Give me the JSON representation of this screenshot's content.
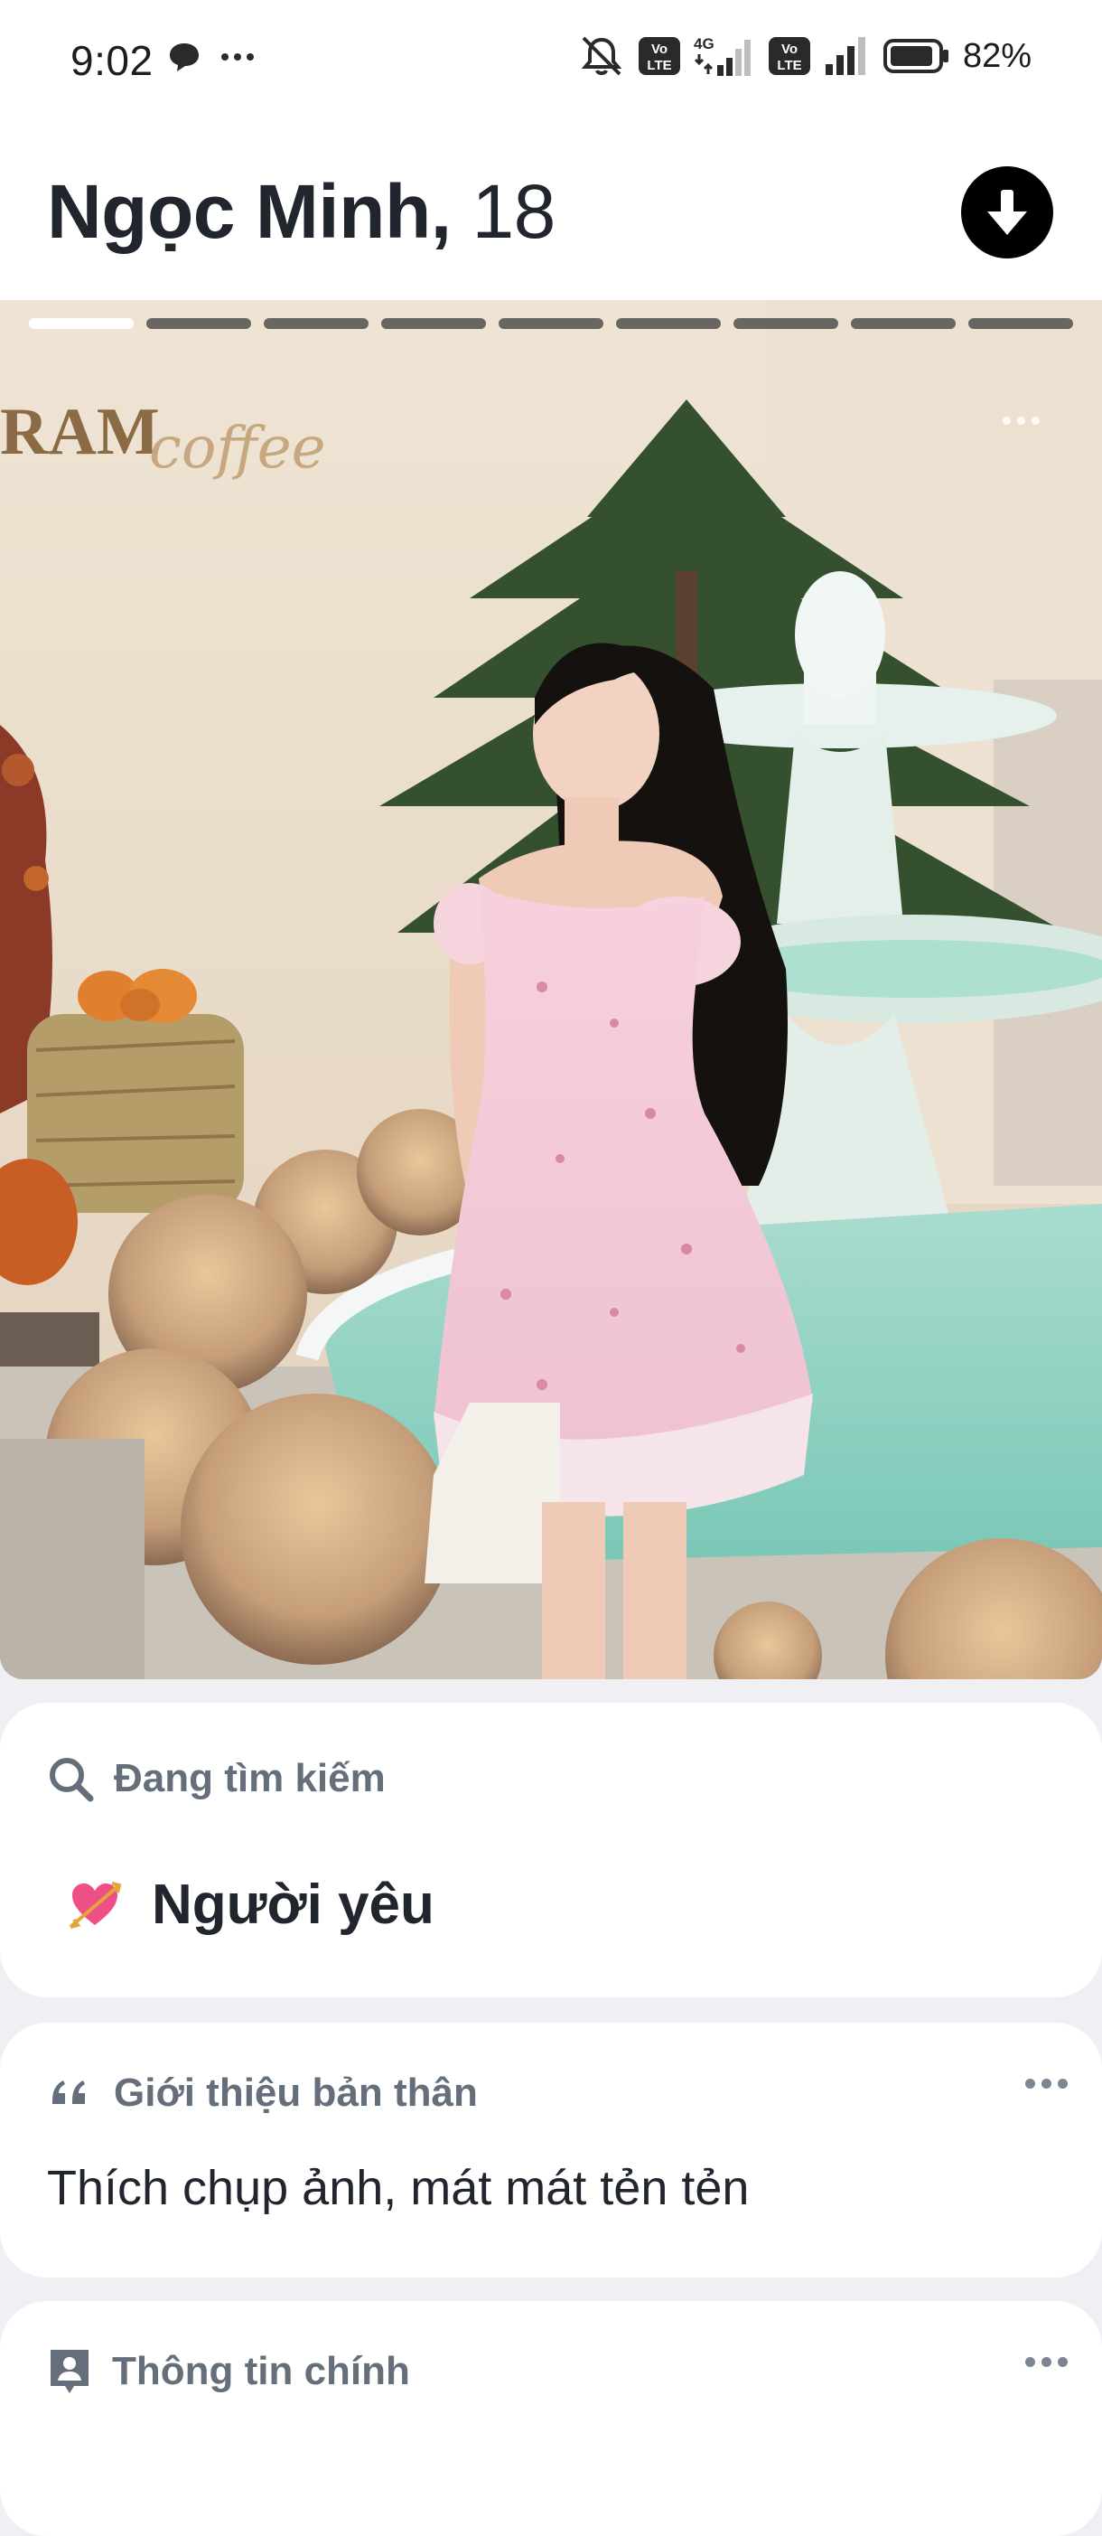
{
  "status_bar": {
    "time": "9:02",
    "battery": "82%",
    "icons": [
      "chat-bubble-icon",
      "more-dots-icon",
      "bell-off-icon",
      "volte-icon",
      "4g-signal-icon",
      "volte-icon",
      "signal-icon",
      "battery-icon"
    ]
  },
  "profile": {
    "name": "Ngọc Minh,",
    "age": "18",
    "photo_count": 9,
    "active_photo_index": 0
  },
  "photo": {
    "sign_text": "RAM",
    "sign_script": "coffee"
  },
  "looking_for": {
    "label": "Đang tìm kiếm",
    "value": "Người yêu",
    "icon": "heart-arrow-icon"
  },
  "about": {
    "label": "Giới thiệu bản thân",
    "text": "Thích chụp ảnh, mát mát tẻn tẻn",
    "icon": "quote-icon"
  },
  "basics": {
    "label": "Thông tin chính",
    "icon": "id-card-icon"
  },
  "colors": {
    "text_dark": "#21262e",
    "text_muted": "#656e7b",
    "background": "#f0eff4"
  }
}
